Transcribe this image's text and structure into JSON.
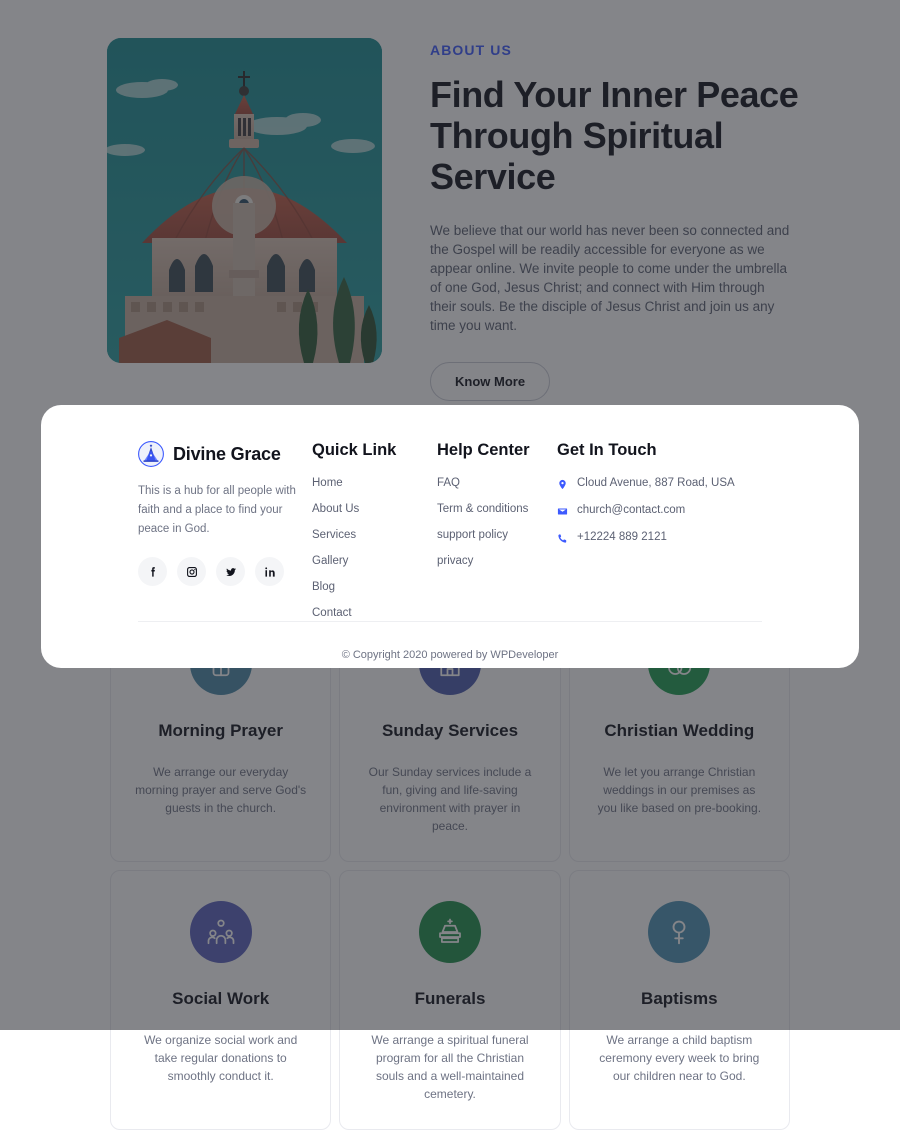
{
  "about": {
    "eyebrow": "ABOUT US",
    "title": "Find Your Inner Peace Through Spiritual Service",
    "paragraph": "We believe that our world has never been so connected and the Gospel will be readily accessible for everyone as we appear online. We invite people to come under the umbrella of one God, Jesus Christ; and connect with Him through their souls. Be the disciple of Jesus Christ and join us any time you want.",
    "button_label": "Know More",
    "image_alt": "church-dome-photo",
    "accent_color": "#3d5afe"
  },
  "services": [
    {
      "title": "Morning Prayer",
      "text": "We arrange our everyday morning prayer and serve God's guests in the church.",
      "icon": "praying-hands-icon",
      "icon_color": "#4a8aa8"
    },
    {
      "title": "Sunday Services",
      "text": "Our Sunday services include a fun, giving and life-saving environment with prayer in peace.",
      "icon": "church-building-icon",
      "icon_color": "#4b5bad"
    },
    {
      "title": "Christian Wedding",
      "text": "We let you arrange Christian weddings in our premises as you like based on pre-booking.",
      "icon": "wedding-rings-icon",
      "icon_color": "#1f9e52"
    },
    {
      "title": "Social Work",
      "text": "We organize social work and take regular donations to smoothly conduct it.",
      "icon": "social-group-icon",
      "icon_color": "#5b63bf"
    },
    {
      "title": "Funerals",
      "text": "We arrange a spiritual funeral program for all the Christian souls and a well-maintained cemetery.",
      "icon": "coffin-icon",
      "icon_color": "#1f8f4c"
    },
    {
      "title": "Baptisms",
      "text": "We arrange a child baptism ceremony every week to bring our children near to God.",
      "icon": "baptism-font-icon",
      "icon_color": "#4e93b5"
    }
  ],
  "footer": {
    "brand": {
      "name": "Divine Grace",
      "logo_icon": "church-badge-icon",
      "description": "This is a hub for all people with faith and a place to find your peace in God.",
      "socials": [
        {
          "name": "facebook-icon",
          "label": "Facebook"
        },
        {
          "name": "instagram-icon",
          "label": "Instagram"
        },
        {
          "name": "twitter-icon",
          "label": "Twitter"
        },
        {
          "name": "linkedin-icon",
          "label": "LinkedIn"
        }
      ]
    },
    "quick_link": {
      "heading": "Quick Link",
      "links": [
        "Home",
        "About Us",
        "Services",
        "Gallery",
        "Blog",
        "Contact"
      ]
    },
    "help_center": {
      "heading": "Help Center",
      "links": [
        "FAQ",
        "Term & conditions",
        "support policy",
        "privacy"
      ]
    },
    "get_in_touch": {
      "heading": "Get In Touch",
      "items": [
        {
          "icon": "location-pin-icon",
          "text": "Cloud Avenue, 887 Road, USA"
        },
        {
          "icon": "envelope-icon",
          "text": "church@contact.com"
        },
        {
          "icon": "phone-icon",
          "text": "+12224 889 2121"
        }
      ]
    },
    "copyright": "© Copyright 2020 powered by WPDeveloper"
  }
}
